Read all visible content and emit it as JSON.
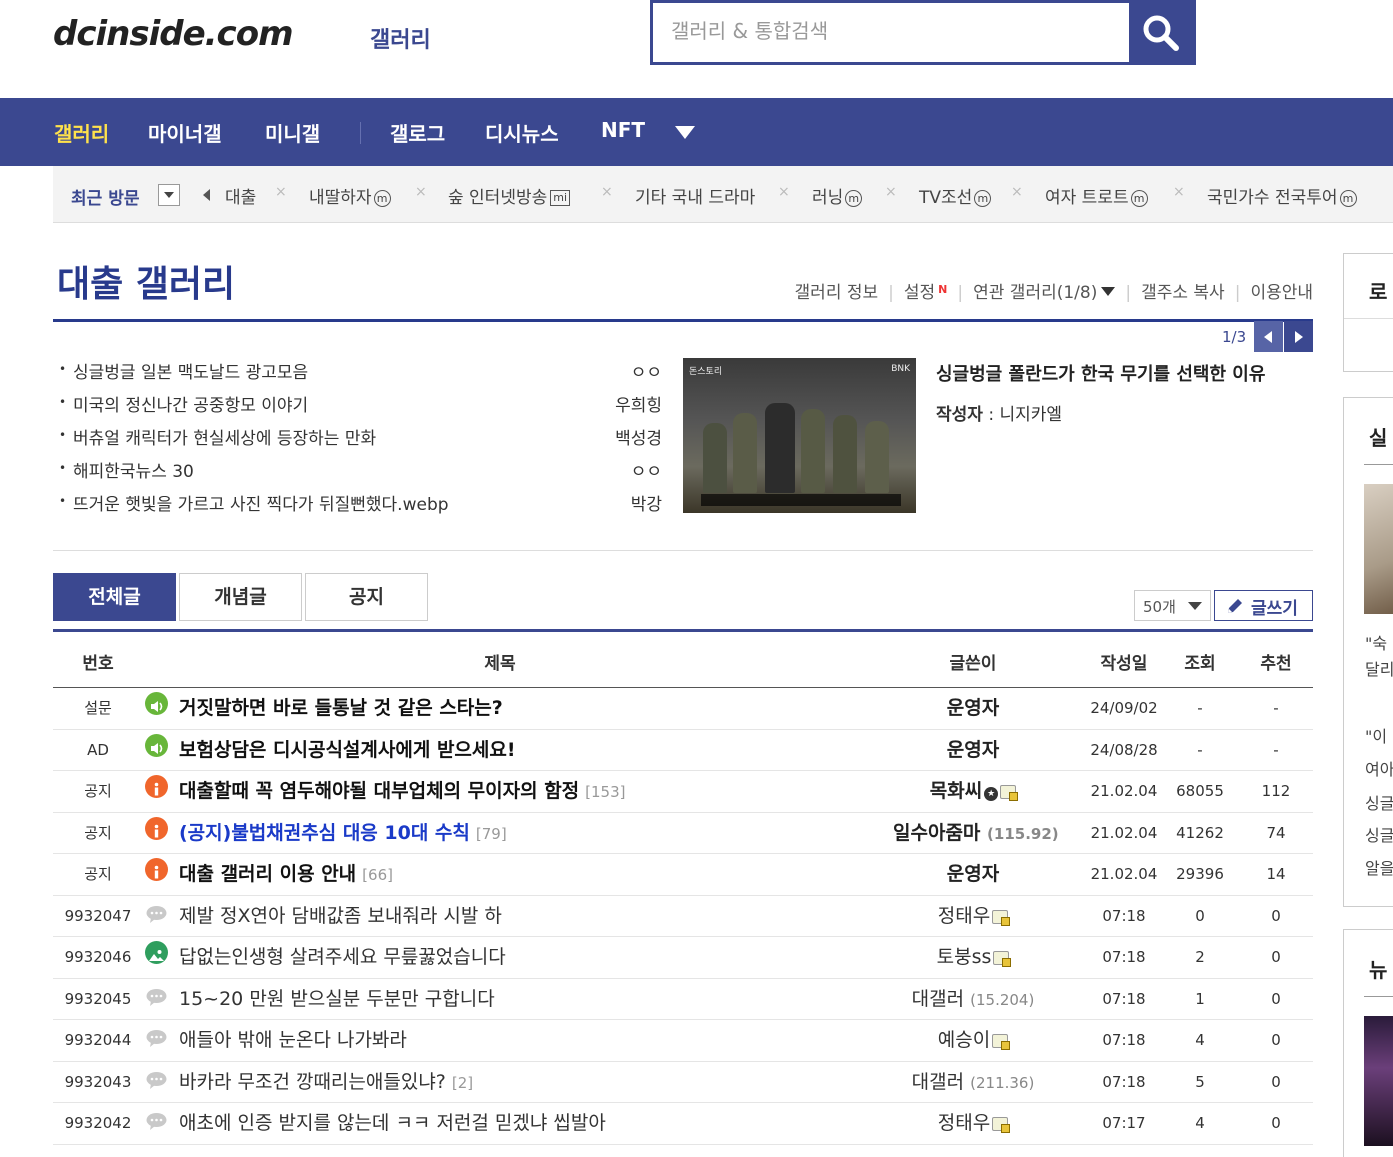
{
  "header": {
    "logo": "dcinside.com",
    "logo_sub": "갤러리",
    "search_placeholder": "갤러리 & 통합검색"
  },
  "nav": {
    "items": [
      "갤러리",
      "마이너갤",
      "미니갤",
      "갤로그",
      "디시뉴스",
      "NFT"
    ]
  },
  "recent": {
    "label": "최근 방문",
    "items": [
      {
        "label": "대출",
        "badge": ""
      },
      {
        "label": "내딸하자",
        "badge": "ⓜ"
      },
      {
        "label": "숲 인터넷방송",
        "badge": "mi"
      },
      {
        "label": "기타 국내 드라마",
        "badge": ""
      },
      {
        "label": "러닝",
        "badge": "ⓜ"
      },
      {
        "label": "TV조선",
        "badge": "ⓜ"
      },
      {
        "label": "여자 트로트",
        "badge": "ⓜ"
      },
      {
        "label": "국민가수 전국투어",
        "badge": "ⓜ"
      }
    ]
  },
  "gallery": {
    "title": "대출 갤러리",
    "links": [
      "갤러리 정보",
      "설정",
      "연관 갤러리(1/8)",
      "갤주소 복사",
      "이용안내"
    ],
    "new_badge": "N"
  },
  "featured": {
    "page": "1/3",
    "list": [
      {
        "title": "싱글벙글 일본 맥도날드 광고모음",
        "author": "ㅇㅇ"
      },
      {
        "title": "미국의 정신나간 공중항모 이야기",
        "author": "우희힝"
      },
      {
        "title": "버츄얼 캐릭터가 현실세상에 등장하는 만화",
        "author": "백성경"
      },
      {
        "title": "해피한국뉴스 30",
        "author": "ㅇㅇ"
      },
      {
        "title": "뜨거운 햇빛을 가르고 사진 찍다가 뒤질뻔했다.webp",
        "author": "박강"
      }
    ],
    "main_title": "싱글벙글 폴란드가 한국 무기를 선택한 이유",
    "main_author_label": "작성자",
    "main_author": "니지카엘",
    "img_tag_left": "돈스토리",
    "img_tag_right": "BNK"
  },
  "tabs": [
    "전체글",
    "개념글",
    "공지"
  ],
  "list_controls": {
    "count": "50개",
    "write": "글쓰기"
  },
  "table": {
    "headers": [
      "번호",
      "제목",
      "글쓴이",
      "작성일",
      "조회",
      "추천"
    ],
    "rows": [
      {
        "num": "설문",
        "icon": "survey",
        "title": "거짓말하면 바로 들통날 것 같은 스타는?",
        "reply": "",
        "writer": "운영자",
        "ip": "",
        "date": "24/09/02",
        "views": "-",
        "rec": "-"
      },
      {
        "num": "AD",
        "icon": "survey",
        "title": "보험상담은 디시공식설계사에게 받으세요!",
        "reply": "",
        "writer": "운영자",
        "ip": "",
        "date": "24/08/28",
        "views": "-",
        "rec": "-"
      },
      {
        "num": "공지",
        "icon": "notice",
        "title": "대출할때 꼭 염두해야될 대부업체의 무이자의 함정",
        "reply": "[153]",
        "writer": "목화씨",
        "ip": "",
        "date": "21.02.04",
        "views": "68055",
        "rec": "112"
      },
      {
        "num": "공지",
        "icon": "notice",
        "title": "(공지)불법채권추심 대응 10대 수칙",
        "reply": "[79]",
        "writer": "일수아줌마",
        "ip": "(115.92)",
        "date": "21.02.04",
        "views": "41262",
        "rec": "74"
      },
      {
        "num": "공지",
        "icon": "notice",
        "title": "대출 갤러리 이용 안내",
        "reply": "[66]",
        "writer": "운영자",
        "ip": "",
        "date": "21.02.04",
        "views": "29396",
        "rec": "14"
      },
      {
        "num": "9932047",
        "icon": "text",
        "title": "제발 정X연아 담배값좀 보내줘라 시발 하",
        "reply": "",
        "writer": "정태우",
        "ip": "",
        "date": "07:18",
        "views": "0",
        "rec": "0"
      },
      {
        "num": "9932046",
        "icon": "image",
        "title": "답없는인생형 살려주세요 무릎꿇었습니다",
        "reply": "",
        "writer": "토붕ss",
        "ip": "",
        "date": "07:18",
        "views": "2",
        "rec": "0"
      },
      {
        "num": "9932045",
        "icon": "text",
        "title": "15~20 만원 받으실분 두분만 구합니다",
        "reply": "",
        "writer": "대갤러",
        "ip": "(15.204)",
        "date": "07:18",
        "views": "1",
        "rec": "0"
      },
      {
        "num": "9932044",
        "icon": "text",
        "title": "애들아 밖애 눈온다 나가봐라",
        "reply": "",
        "writer": "예승이",
        "ip": "",
        "date": "07:18",
        "views": "4",
        "rec": "0"
      },
      {
        "num": "9932043",
        "icon": "text",
        "title": "바카라 무조건 깡때리는애들있냐?",
        "reply": "[2]",
        "writer": "대갤러",
        "ip": "(211.36)",
        "date": "07:18",
        "views": "5",
        "rec": "0"
      },
      {
        "num": "9932042",
        "icon": "text",
        "title": "애초에 인증 받지를 않는데 ㅋㅋ 저런걸 믿겠냐 씹발아",
        "reply": "",
        "writer": "정태우",
        "ip": "",
        "date": "07:17",
        "views": "4",
        "rec": "0"
      }
    ]
  },
  "right": {
    "login_head": "로",
    "box2_head": "실",
    "box3_head": "뉴",
    "texts": [
      "\"숙",
      "달리",
      "\"이",
      "여아",
      "싱글",
      "싱글",
      "알을"
    ]
  },
  "colors": {
    "brand": "#3b4890",
    "active_nav": "#ffe24c",
    "notice_icon": "#f0662c",
    "survey_icon": "#68b63a",
    "blue_title": "#1a3ac8"
  }
}
